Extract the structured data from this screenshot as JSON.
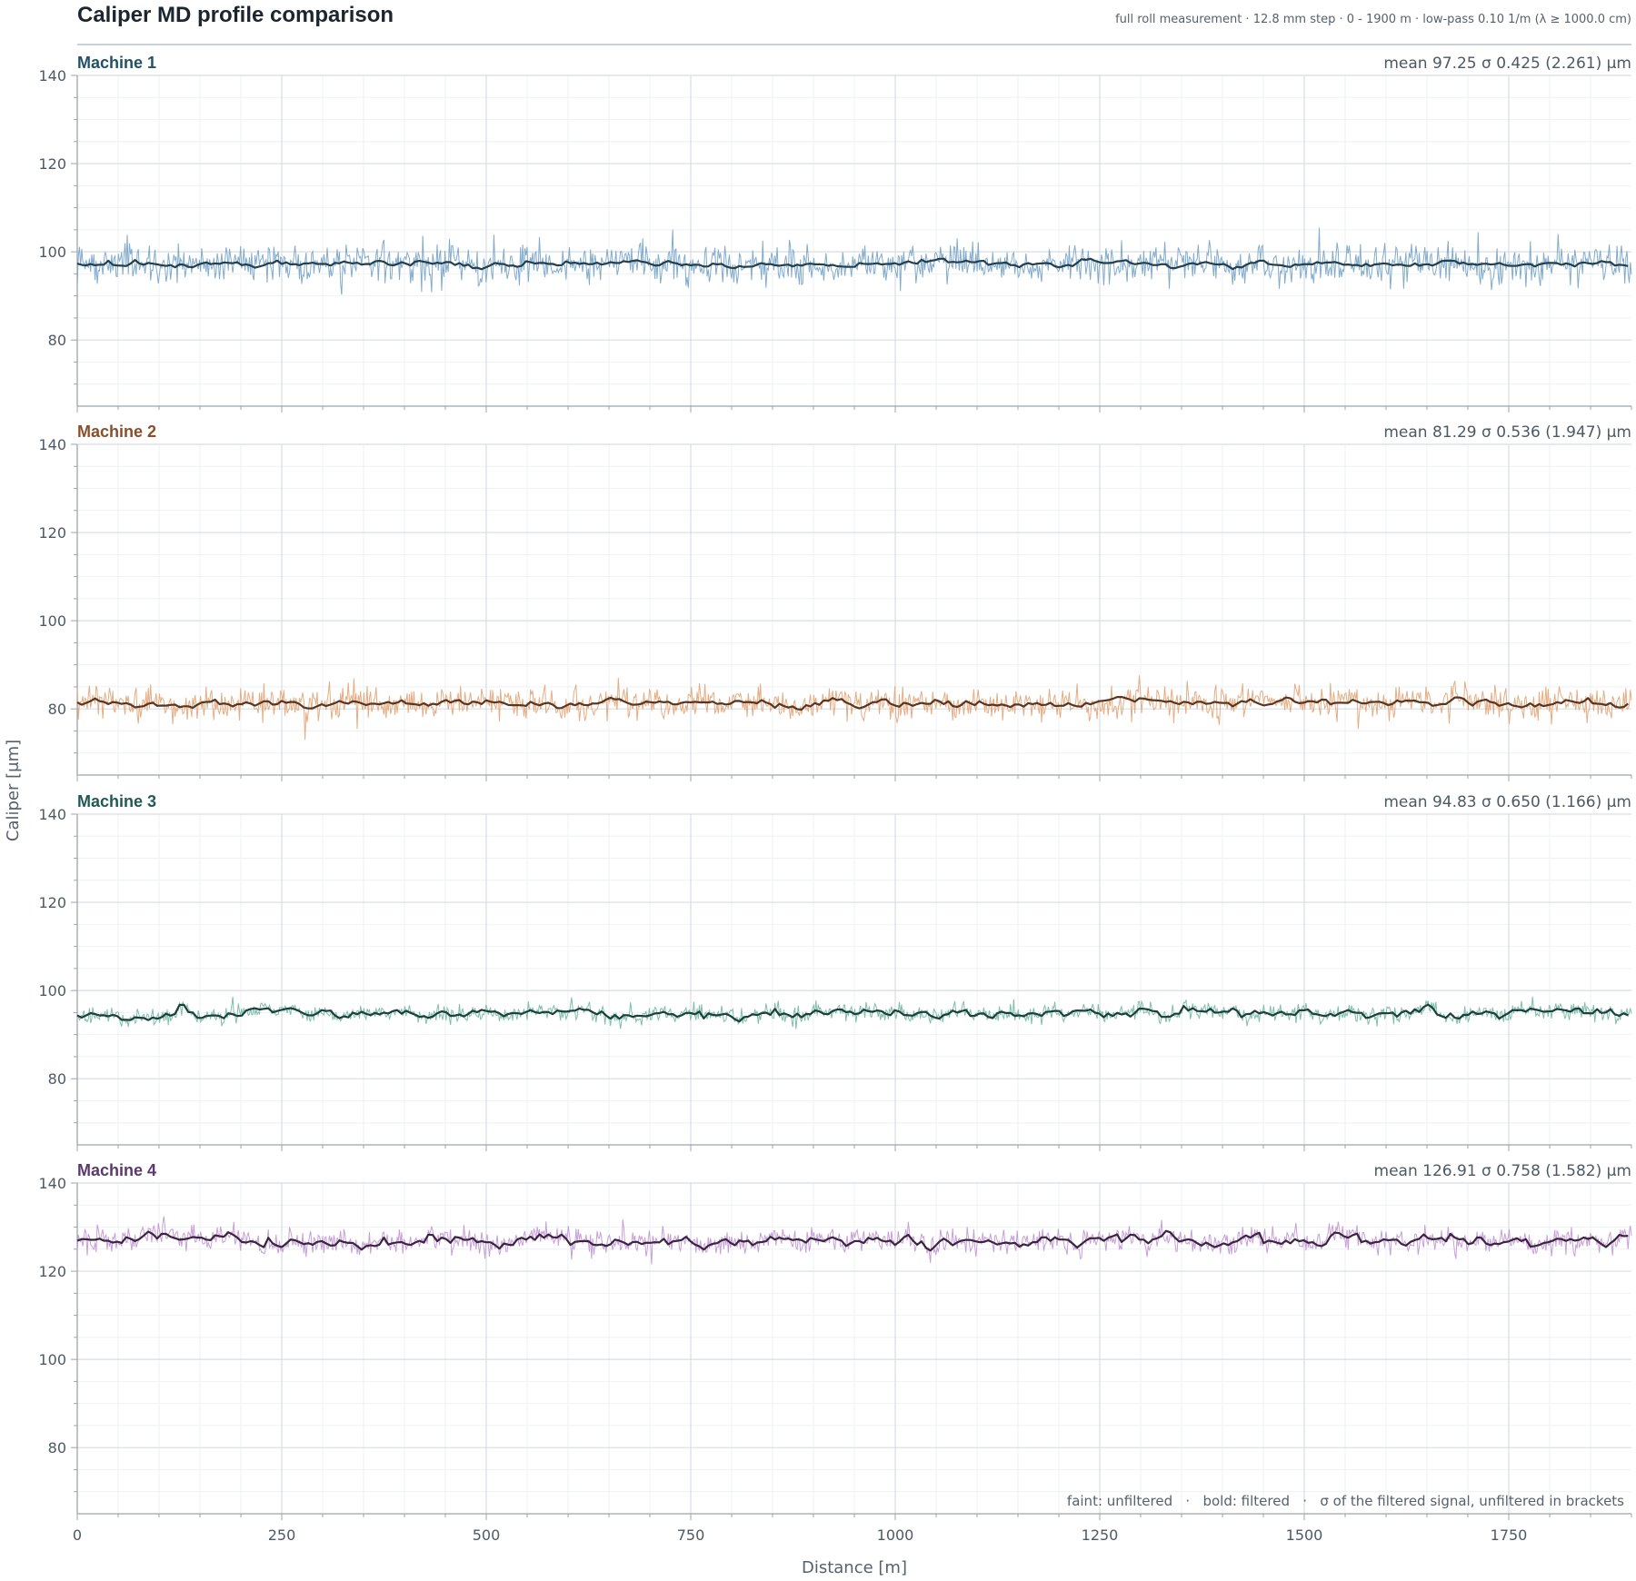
{
  "header": {
    "title": "Caliper MD profile comparison",
    "subtitle": "full roll measurement · 12.8 mm step · 0 - 1900 m · low-pass 0.10 1/m (λ ≥ 1000.0 cm)"
  },
  "footnote": "faint: unfiltered   ·   bold: filtered   ·   σ of the filtered signal, unfiltered in brackets",
  "chart_data": {
    "type": "line",
    "xlabel": "Distance [m]",
    "ylabel": "Caliper [μm]",
    "xlim": [
      0,
      1900
    ],
    "ylim": [
      65,
      140
    ],
    "x_ticks": [
      0,
      250,
      500,
      750,
      1000,
      1250,
      1500,
      1750
    ],
    "y_ticks": [
      80,
      100,
      120,
      140
    ],
    "grid": true,
    "shared_x_axis": true,
    "series": [
      {
        "name": "Machine 1",
        "stats": "mean 97.25   σ 0.425 (2.261) μm",
        "mean": 97.25,
        "sigma_filtered": 0.425,
        "sigma_unfiltered": 2.261,
        "raw_color": "#7ba7c9",
        "filtered_color": "#223f4e",
        "label_color": "#1f5168"
      },
      {
        "name": "Machine 2",
        "stats": "mean 81.29   σ 0.536 (1.947) μm",
        "mean": 81.29,
        "sigma_filtered": 0.536,
        "sigma_unfiltered": 1.947,
        "raw_color": "#e3a97c",
        "filtered_color": "#5a3420",
        "label_color": "#8a4f2a"
      },
      {
        "name": "Machine 3",
        "stats": "mean 94.83   σ 0.650 (1.166) μm",
        "mean": 94.83,
        "sigma_filtered": 0.65,
        "sigma_unfiltered": 1.166,
        "raw_color": "#78bba8",
        "filtered_color": "#1c3f38",
        "label_color": "#1f5a55"
      },
      {
        "name": "Machine 4",
        "stats": "mean 126.91   σ 0.758 (1.582) μm",
        "mean": 126.91,
        "sigma_filtered": 0.758,
        "sigma_unfiltered": 1.582,
        "raw_color": "#c49ad6",
        "filtered_color": "#3b2440",
        "label_color": "#5b3a6b"
      }
    ]
  }
}
